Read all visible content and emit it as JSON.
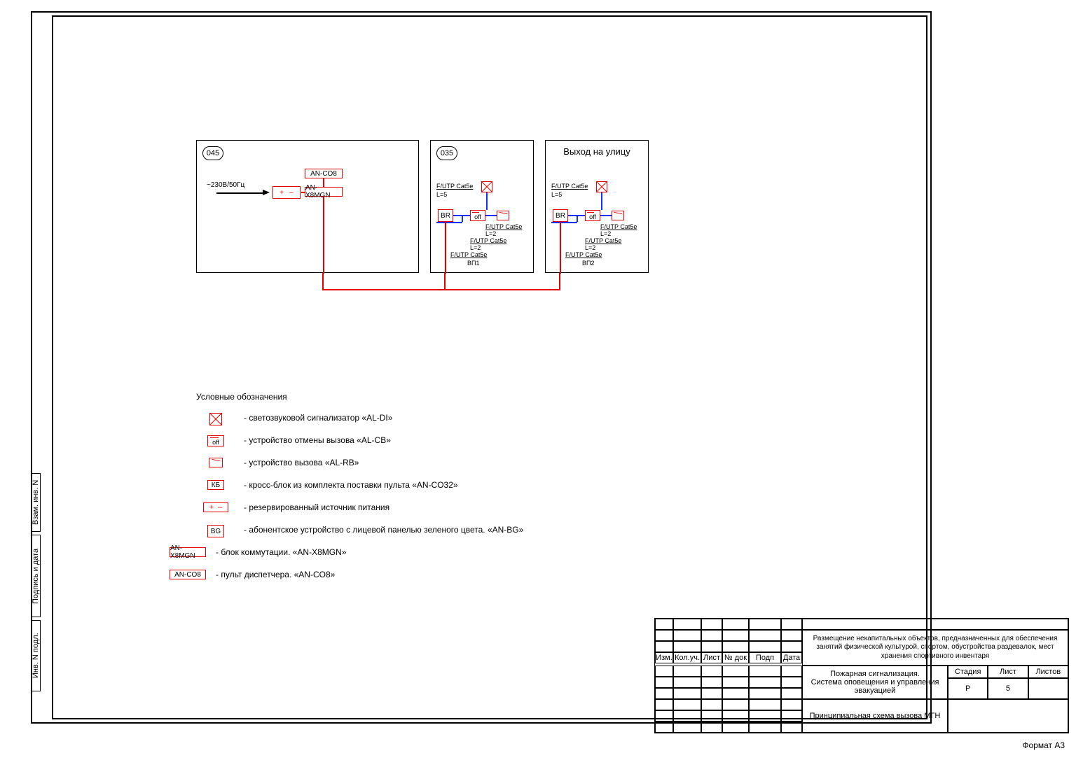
{
  "sheet": {
    "format": "Формат А3"
  },
  "side_tabs": {
    "t1": "Взам. инв. N",
    "t2": "Подпись и дата",
    "t3": "Инв. N подл."
  },
  "rooms": {
    "r045": {
      "num": "045",
      "power": "~230В/50Гц",
      "module1": "AN-CO8",
      "module2": "AN-X8MGN",
      "plus": "+",
      "minus": "–"
    },
    "r035": {
      "num": "035",
      "cable1": "F/UTP Cat5e",
      "l5": "L=5",
      "br": "BR",
      "off": "off",
      "cable2": "F/UTP Cat5e",
      "l2a": "L=2",
      "cable3": "F/UTP Cat5e",
      "l2b": "L=2",
      "cable4": "F/UTP Cat5e",
      "bp": "ВП1"
    },
    "rExit": {
      "title": "Выход на улицу",
      "cable1": "F/UTP Cat5e",
      "l5": "L=5",
      "br": "BR",
      "off": "off",
      "cable2": "F/UTP Cat5e",
      "l2a": "L=2",
      "cable3": "F/UTP Cat5e",
      "l2b": "L=2",
      "cable4": "F/UTP Cat5e",
      "bp": "ВП2"
    }
  },
  "legend": {
    "title": "Условные обозначения",
    "items": {
      "x": "-  светозвуковой сигнализатор «AL-DI»",
      "off_label": "off",
      "off": "-  устройство отмены вызова «AL-CB»",
      "call": "-  устройство вызова «AL-RB»",
      "kb_label": "КБ",
      "kb": "-  кросс-блок из комплекта поставки пульта «AN-CO32»",
      "psu_label_p": "+",
      "psu_label_m": "–",
      "psu": "-  резервированный источник питания",
      "bg_label": "BG",
      "bg": "-  абонентское устройство с лицевой панелью зеленого цвета. «AN-BG»",
      "x8_label": "AN-X8MGN",
      "x8": "-  блок коммутации. «AN-X8MGN»",
      "co8_label": "AN-CO8",
      "co8": "-  пульт диспетчера. «AN-CO8»"
    }
  },
  "title_block": {
    "headers": {
      "izm": "Изм.",
      "kol": "Кол.уч.",
      "list": "Лист",
      "ndok": "№ док",
      "podp": "Подп",
      "data": "Дата"
    },
    "project": "Размещение некапитальных объектов, предназначенных для обеспечения занятий физической культурой, спортом, обустройства раздевалок, мест хранения спортивного инвентаря",
    "system_title": "Пожарная сигнализация.\nСистема оповещения и управления\nэвакуацией",
    "cols": {
      "stadia": "Стадия",
      "list": "Лист",
      "listov": "Листов"
    },
    "vals": {
      "stadia": "Р",
      "list": "5",
      "listov": ""
    },
    "drawing_title": "Принципиальная схема вызова МГН"
  }
}
